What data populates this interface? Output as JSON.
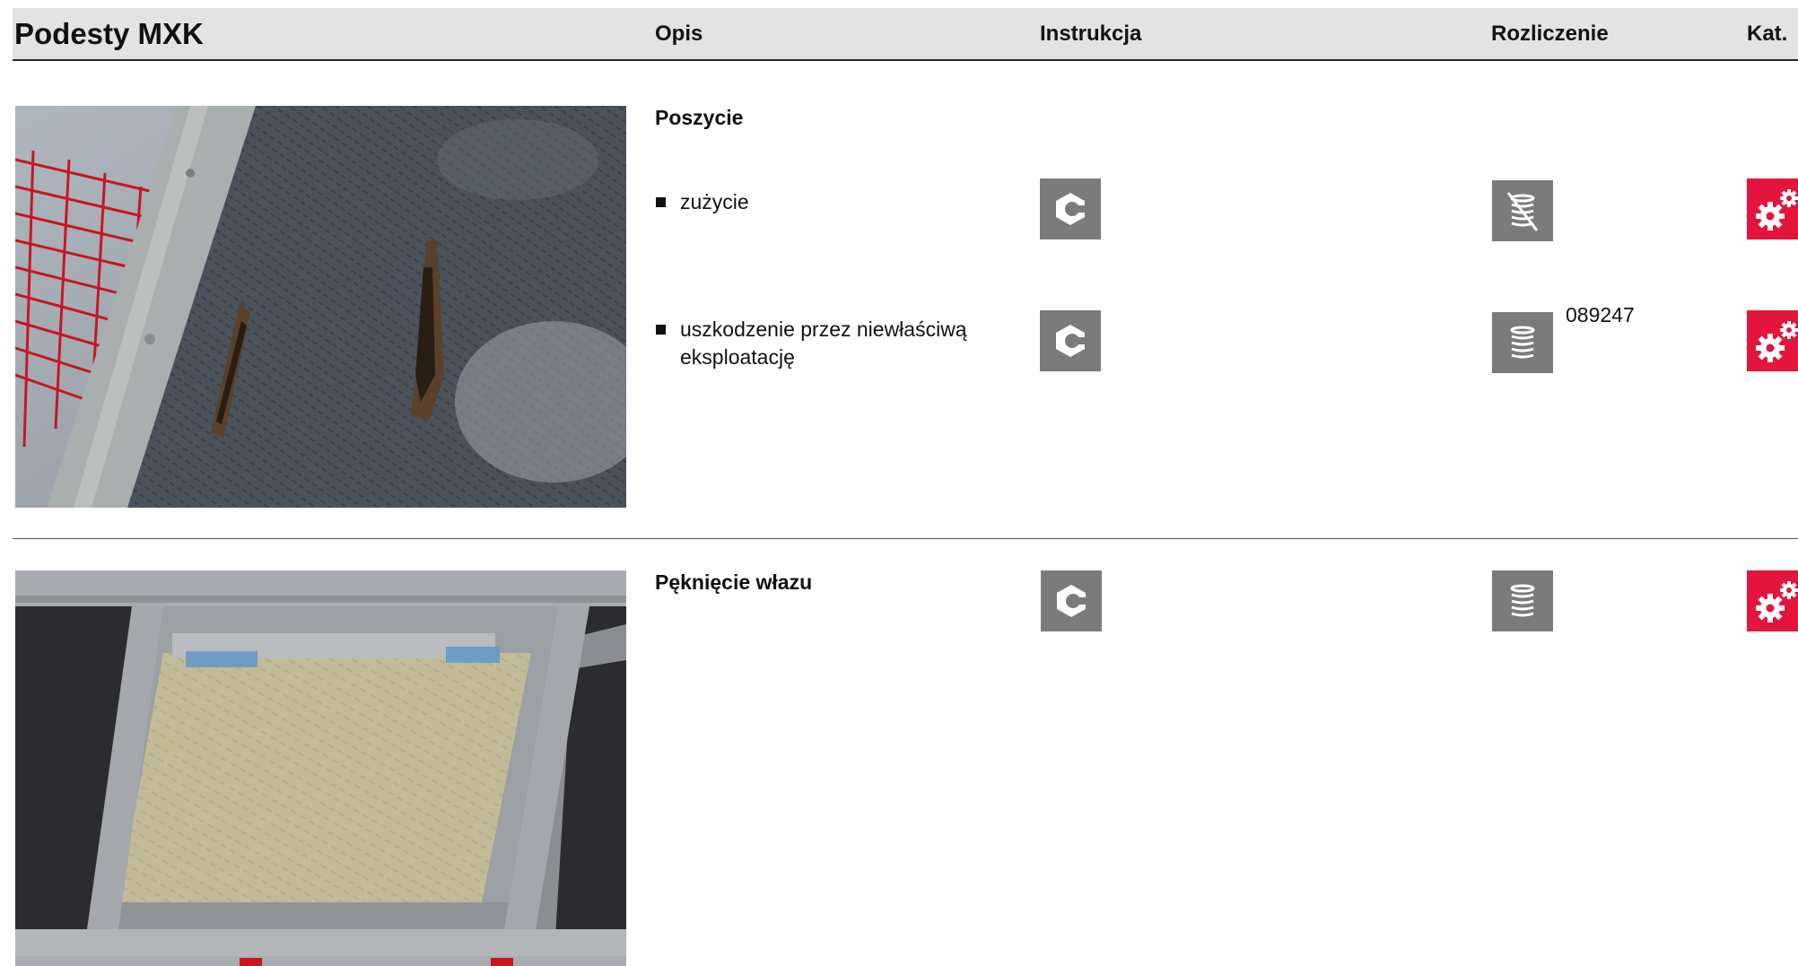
{
  "header": {
    "title": "Podesty MXK",
    "columns": {
      "opis": "Opis",
      "instrukcja": "Instrukcja",
      "rozliczenie": "Rozliczenie",
      "kat": "Kat."
    }
  },
  "sections": [
    {
      "heading": "Poszycie",
      "items": [
        {
          "label": "zużycie",
          "instruction_icon": "nut-icon",
          "billing_icon": "coins-crossed-icon",
          "code": "",
          "category_icon": "gears-icon"
        },
        {
          "label": "uszkodzenie przez niewłaściwą eksploatację",
          "instruction_icon": "nut-icon",
          "billing_icon": "coins-icon",
          "code": "089247",
          "category_icon": "gears-icon"
        }
      ]
    },
    {
      "heading": "Pęknięcie włazu",
      "instruction_icon": "nut-icon",
      "billing_icon": "coins-icon",
      "code": "",
      "category_icon": "gears-icon"
    }
  ],
  "colors": {
    "icon_gray": "#7b7b7b",
    "category_red": "#e3153d",
    "header_bg": "#e3e3e3"
  }
}
